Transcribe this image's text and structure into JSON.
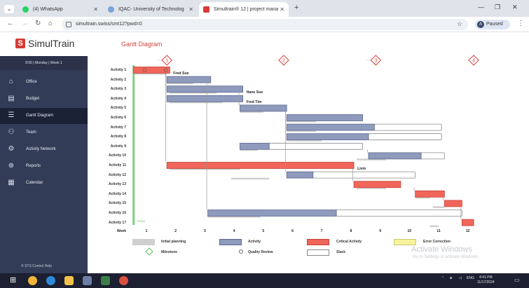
{
  "browser": {
    "tabs": [
      {
        "label": "(4) WhatsApp",
        "icon": "whatsapp-icon",
        "color": "#25d366",
        "active": false
      },
      {
        "label": "IQAC- University of Technolog",
        "icon": "university-icon",
        "color": "#7aa5d9",
        "active": false
      },
      {
        "label": "Simultrain® 12 | project manag",
        "icon": "simultrain-icon",
        "color": "#d63b36",
        "active": true
      }
    ],
    "new_tab": "+",
    "url": "simultrain.swiss/smt12?pwd=0",
    "profile_initial": "A",
    "profile_status": "Paused"
  },
  "app": {
    "logo_text": "SimulTrain",
    "logo_mark": "S",
    "session_line": "8:00 | Monday | Week 1",
    "nav": [
      {
        "label": "Office",
        "icon": "office-icon",
        "glyph": "⌂",
        "active": false
      },
      {
        "label": "Budget",
        "icon": "budget-icon",
        "glyph": "▤",
        "active": false
      },
      {
        "label": "Gantt Diagram",
        "icon": "gantt-icon",
        "glyph": "☰",
        "active": true
      },
      {
        "label": "Team",
        "icon": "team-icon",
        "glyph": "⚇",
        "active": false
      },
      {
        "label": "Activity Network",
        "icon": "network-icon",
        "glyph": "⚙",
        "active": false
      },
      {
        "label": "Reports",
        "icon": "reports-icon",
        "glyph": "⊕",
        "active": false
      },
      {
        "label": "Calendar",
        "icon": "calendar-icon",
        "glyph": "▦",
        "active": false
      }
    ],
    "footer": "© STS    Control    Help"
  },
  "page": {
    "title": "Gantt Diagram",
    "week_label": "Week",
    "today_label": "Today"
  },
  "chart_data": {
    "type": "gantt",
    "x_unit": "week",
    "weeks": [
      "1",
      "2",
      "3",
      "4",
      "5",
      "6",
      "7",
      "8",
      "9",
      "10",
      "11",
      "12"
    ],
    "milestones": [
      {
        "label": "1",
        "week": 1.7
      },
      {
        "label": "2",
        "week": 5.7
      },
      {
        "label": "3",
        "week": 8.85
      },
      {
        "label": "4",
        "week": 12.2
      }
    ],
    "activities": [
      {
        "name": "Activity 1",
        "kind": "critical",
        "start": 0.55,
        "end": 1.8,
        "slack_end": null,
        "plan": [
          0.6,
          1.7
        ],
        "resource": "Fred Sue",
        "quality_review": true
      },
      {
        "name": "Activity 2",
        "kind": "activity",
        "start": 1.7,
        "end": 3.2,
        "slack_end": null,
        "plan": [
          1.7,
          2.6
        ],
        "resource": "",
        "quality_review": false
      },
      {
        "name": "Activity 3",
        "kind": "activity",
        "start": 1.7,
        "end": 4.3,
        "slack_end": null,
        "plan": [
          1.8,
          3.4
        ],
        "resource": "Hans Sue",
        "quality_review": false
      },
      {
        "name": "Activity 4",
        "kind": "activity",
        "start": 1.7,
        "end": 4.3,
        "slack_end": null,
        "plan": [
          1.8,
          3.6
        ],
        "resource": "Fred Tim",
        "quality_review": false
      },
      {
        "name": "Activity 5",
        "kind": "activity",
        "start": 4.2,
        "end": 5.8,
        "slack_end": null,
        "plan": [
          4.2,
          5.0
        ],
        "resource": "",
        "quality_review": false
      },
      {
        "name": "Activity 6",
        "kind": "activity",
        "start": 5.8,
        "end": 8.4,
        "slack_end": null,
        "plan": [
          5.8,
          6.8
        ],
        "resource": "",
        "quality_review": false
      },
      {
        "name": "Activity 7",
        "kind": "activity",
        "start": 5.8,
        "end": 8.8,
        "slack_end": 11.1,
        "plan": [
          5.8,
          6.8
        ],
        "resource": "",
        "quality_review": false
      },
      {
        "name": "Activity 8",
        "kind": "activity",
        "start": 5.8,
        "end": 8.6,
        "slack_end": 11.1,
        "plan": [
          5.8,
          7.0
        ],
        "resource": "",
        "quality_review": false
      },
      {
        "name": "Activity 9",
        "kind": "activity",
        "start": 4.2,
        "end": 5.2,
        "slack_end": 8.4,
        "plan": [
          4.2,
          4.8
        ],
        "resource": "",
        "quality_review": false
      },
      {
        "name": "Activity 10",
        "kind": "activity",
        "start": 8.6,
        "end": 10.4,
        "slack_end": 11.2,
        "plan": [
          8.2,
          9.2
        ],
        "resource": "",
        "quality_review": false
      },
      {
        "name": "Activity 11",
        "kind": "critical",
        "start": 1.7,
        "end": 8.1,
        "slack_end": null,
        "plan": [
          1.8,
          4.2
        ],
        "resource": "Livio",
        "quality_review": false
      },
      {
        "name": "Activity 12",
        "kind": "activity",
        "start": 5.8,
        "end": 6.7,
        "slack_end": 10.2,
        "plan": [
          3.9,
          5.2
        ],
        "resource": "",
        "quality_review": false
      },
      {
        "name": "Activity 13",
        "kind": "critical",
        "start": 8.1,
        "end": 9.7,
        "slack_end": null,
        "plan": [
          8.2,
          9.2
        ],
        "resource": "",
        "quality_review": false
      },
      {
        "name": "Activity 14",
        "kind": "critical",
        "start": 10.2,
        "end": 11.2,
        "slack_end": null,
        "plan": [
          10.2,
          10.7
        ],
        "resource": "",
        "quality_review": false
      },
      {
        "name": "Activity 15",
        "kind": "critical",
        "start": 11.2,
        "end": 11.8,
        "slack_end": null,
        "plan": [
          10.8,
          11.2
        ],
        "resource": "",
        "quality_review": false
      },
      {
        "name": "Activity 16",
        "kind": "activity",
        "start": 3.1,
        "end": 7.5,
        "slack_end": 11.8,
        "plan": [
          3.1,
          4.9
        ],
        "resource": "",
        "quality_review": false
      },
      {
        "name": "Activity 17",
        "kind": "critical",
        "start": 11.8,
        "end": 12.2,
        "slack_end": null,
        "plan": [
          10.7,
          11.0
        ],
        "resource": "",
        "quality_review": false
      }
    ],
    "legend": [
      {
        "label": "Initial planning",
        "swatch": "#cfcfcf",
        "border": "#cfcfcf"
      },
      {
        "label": "Activity",
        "swatch": "#8f9bbd",
        "border": "#5d6a8d"
      },
      {
        "label": "Critical Activity",
        "swatch": "#f1665a",
        "border": "#c54237"
      },
      {
        "label": "Error Correction",
        "swatch": "#f6f39b",
        "border": "#c9c677"
      },
      {
        "label": "Milestone",
        "swatch": "diamond",
        "border": "#5cbf5c"
      },
      {
        "label": "Quality Review",
        "swatch": "circle",
        "border": "#666666"
      },
      {
        "label": "Slack",
        "swatch": "#ffffff",
        "border": "#8a8a8a"
      }
    ],
    "colors": {
      "activity": "#8f9bbd",
      "activity_border": "#5d6a8d",
      "critical": "#f1665a",
      "critical_border": "#c54237",
      "plan": "#cfcfcf",
      "today": "#7fd07f",
      "dependency": "#9a9a9a",
      "milestone_active": "#d8433a",
      "milestone_passive": "#c5c5c5"
    }
  },
  "watermark": {
    "title": "Activate Windows",
    "subtitle": "Go to Settings to activate Windows."
  },
  "taskbar": {
    "lang": "ENG",
    "time": "4:41 PM",
    "date": "11/17/2024"
  }
}
